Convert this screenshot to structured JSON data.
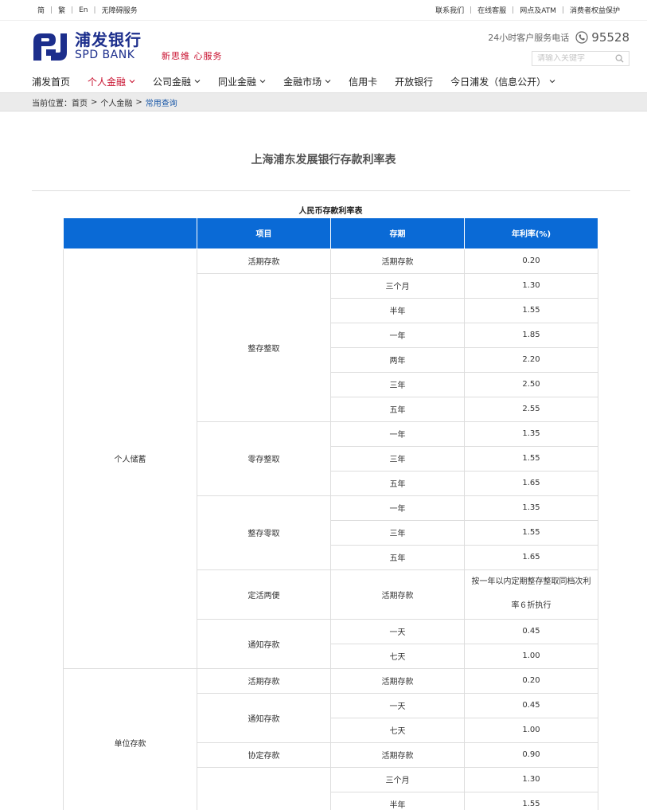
{
  "topbar": {
    "lang_simplified": "简",
    "lang_traditional": "繁",
    "lang_en": "En",
    "accessibility": "无障碍服务",
    "contact": "联系我们",
    "online_service": "在线客服",
    "branch_atm": "网点及ATM",
    "consumer_protection": "消费者权益保护"
  },
  "header": {
    "logo_cn": "浦发银行",
    "logo_en": "SPD BANK",
    "slogan": "新思维  心服务",
    "hotline_label": "24小时客户服务电话",
    "hotline_number": "95528",
    "search_placeholder": "请输入关键字"
  },
  "nav": {
    "items": [
      {
        "label": "浦发首页"
      },
      {
        "label": "个人金融"
      },
      {
        "label": "公司金融"
      },
      {
        "label": "同业金融"
      },
      {
        "label": "金融市场"
      },
      {
        "label": "信用卡"
      },
      {
        "label": "开放银行"
      },
      {
        "label": "今日浦发（信息公开）"
      }
    ]
  },
  "breadcrumb": {
    "label": "当前位置：",
    "home": "首页",
    "personal": "个人金融",
    "current": "常用查询",
    "sep": ">"
  },
  "page": {
    "title": "上海浦东发展银行存款利率表",
    "table_caption": "人民币存款利率表"
  },
  "table": {
    "headers": [
      "",
      "项目",
      "存期",
      "年利率(%)"
    ],
    "groups": [
      {
        "category": "个人储蓄",
        "items": [
          {
            "name": "活期存款",
            "rows": [
              [
                "活期存款",
                "0.20"
              ]
            ]
          },
          {
            "name": "整存整取",
            "rows": [
              [
                "三个月",
                "1.30"
              ],
              [
                "半年",
                "1.55"
              ],
              [
                "一年",
                "1.85"
              ],
              [
                "两年",
                "2.20"
              ],
              [
                "三年",
                "2.50"
              ],
              [
                "五年",
                "2.55"
              ]
            ]
          },
          {
            "name": "零存整取",
            "rows": [
              [
                "一年",
                "1.35"
              ],
              [
                "三年",
                "1.55"
              ],
              [
                "五年",
                "1.65"
              ]
            ]
          },
          {
            "name": "整存零取",
            "rows": [
              [
                "一年",
                "1.35"
              ],
              [
                "三年",
                "1.55"
              ],
              [
                "五年",
                "1.65"
              ]
            ]
          },
          {
            "name": "定活两便",
            "rows": [
              [
                "活期存款",
                "按一年以内定期整存整取同档次利率６折执行"
              ]
            ],
            "tall": true
          },
          {
            "name": "通知存款",
            "rows": [
              [
                "一天",
                "0.45"
              ],
              [
                "七天",
                "1.00"
              ]
            ]
          }
        ]
      },
      {
        "category": "单位存款",
        "items": [
          {
            "name": "活期存款",
            "rows": [
              [
                "活期存款",
                "0.20"
              ]
            ]
          },
          {
            "name": "通知存款",
            "rows": [
              [
                "一天",
                "0.45"
              ],
              [
                "七天",
                "1.00"
              ]
            ]
          },
          {
            "name": "协定存款",
            "rows": [
              [
                "活期存款",
                "0.90"
              ]
            ]
          },
          {
            "name": "",
            "rows": [
              [
                "三个月",
                "1.30"
              ],
              [
                "半年",
                "1.55"
              ]
            ]
          }
        ]
      }
    ]
  }
}
